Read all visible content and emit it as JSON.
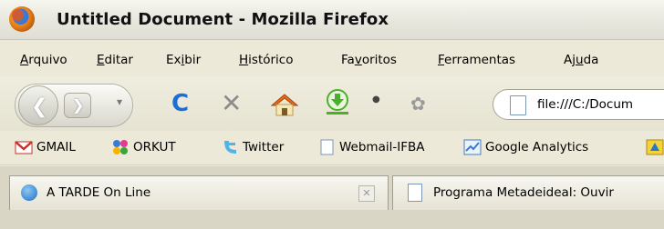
{
  "window": {
    "title": "Untitled Document - Mozilla Firefox"
  },
  "menu": [
    {
      "pre": "",
      "ul": "A",
      "post": "rquivo"
    },
    {
      "pre": "",
      "ul": "E",
      "post": "ditar"
    },
    {
      "pre": "Ex",
      "ul": "i",
      "post": "bir"
    },
    {
      "pre": "",
      "ul": "H",
      "post": "istórico"
    },
    {
      "pre": "Fa",
      "ul": "v",
      "post": "oritos"
    },
    {
      "pre": "",
      "ul": "F",
      "post": "erramentas"
    },
    {
      "pre": "Aj",
      "ul": "u",
      "post": "da"
    }
  ],
  "toolbar": {
    "url": "file:///C:/Docum"
  },
  "bookmarks": [
    {
      "label": "GMAIL",
      "icon": "gmail-icon"
    },
    {
      "label": "ORKUT",
      "icon": "orkut-icon"
    },
    {
      "label": "Twitter",
      "icon": "twitter-icon"
    },
    {
      "label": "Webmail-IFBA",
      "icon": "page-icon"
    },
    {
      "label": "Google Analytics",
      "icon": "analytics-icon"
    }
  ],
  "tabs": [
    {
      "label": "A TARDE On Line",
      "icon": "site-icon"
    },
    {
      "label": "Programa Metadeideal: Ouvir",
      "icon": "page-icon"
    }
  ],
  "colors": {
    "chrome": "#ece9d8",
    "reload": "#1c6fd4",
    "home_roof": "#e86b16",
    "download": "#4caf2a"
  }
}
